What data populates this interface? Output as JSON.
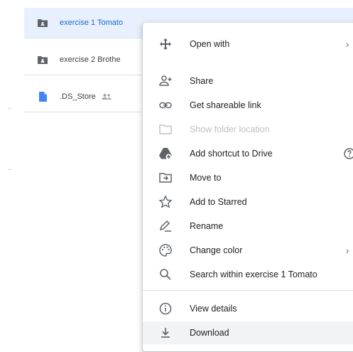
{
  "files": [
    {
      "name": "exercise 1 Tomato",
      "type": "folder",
      "selected": true
    },
    {
      "name": "exercise 2 Brothe",
      "type": "folder",
      "selected": false
    },
    {
      "name": ".DS_Store",
      "type": "file",
      "shared": true,
      "selected": false
    }
  ],
  "context_menu": {
    "open_with": "Open with",
    "share": "Share",
    "get_link": "Get shareable link",
    "show_location": "Show folder location",
    "add_shortcut": "Add shortcut to Drive",
    "move_to": "Move to",
    "add_starred": "Add to Starred",
    "rename": "Rename",
    "change_color": "Change color",
    "search_within": "Search within exercise 1 Tomato",
    "view_details": "View details",
    "download": "Download",
    "submenu_arrow": "›"
  },
  "colors": {
    "selected_bg": "#e8f0fe",
    "selected_text": "#1967d2",
    "icon_gray": "#5f6368",
    "file_blue": "#4285f4"
  }
}
